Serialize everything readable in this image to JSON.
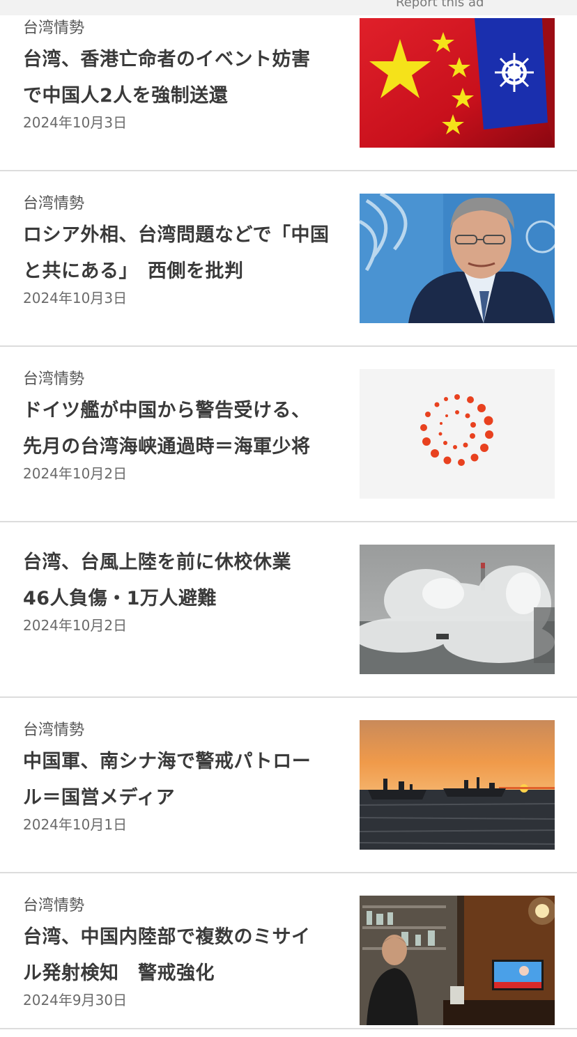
{
  "ad": {
    "report_label": "Report this ad"
  },
  "articles": [
    {
      "category": "台湾情勢",
      "headline_line1": "台湾、香港亡命者のイベント妨害",
      "headline_line2": "で中国人2人を強制送還",
      "date": "2024年10月3日",
      "image": "china-taiwan-flags"
    },
    {
      "category": "台湾情勢",
      "headline_line1": "ロシア外相、台湾問題などで「中国",
      "headline_line2": "と共にある」　西側を批判",
      "date": "2024年10月3日",
      "image": "russian-foreign-minister-portrait"
    },
    {
      "category": "台湾情勢",
      "headline_line1": "ドイツ艦が中国から警告受ける、",
      "headline_line2": "先月の台湾海峡通過時＝海軍少将",
      "date": "2024年10月2日",
      "image": "placeholder-dot-logo"
    },
    {
      "category": "",
      "headline_line1": "台湾、台風上陸を前に休校休業",
      "headline_line2": "46人負傷・1万人避難",
      "date": "2024年10月2日",
      "image": "typhoon-waves"
    },
    {
      "category": "台湾情勢",
      "headline_line1": "中国軍、南シナ海で警戒パトロー",
      "headline_line2": "ル＝国営メディア",
      "date": "2024年10月1日",
      "image": "ships-at-sunset"
    },
    {
      "category": "台湾情勢",
      "headline_line1": "台湾、中国内陸部で複数のミサイ",
      "headline_line2": "ル発射検知　警戒強化",
      "date": "2024年9月30日",
      "image": "shop-with-tv-news"
    }
  ],
  "colors": {
    "accent_red": "#e8411f",
    "divider": "#dcdcdc",
    "headline": "#3a3a3a"
  }
}
